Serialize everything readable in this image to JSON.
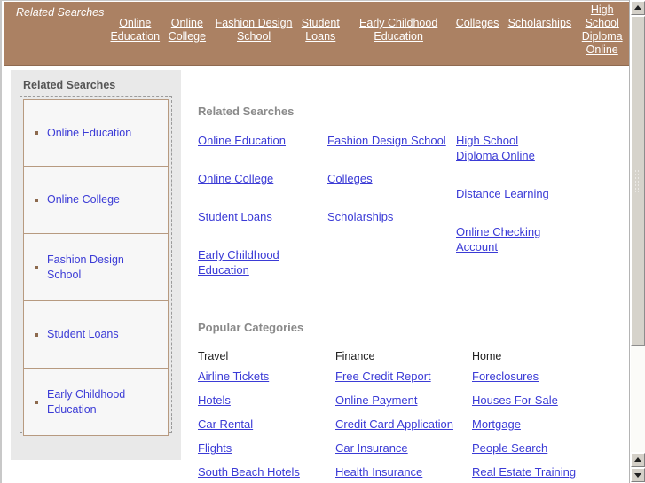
{
  "banner": {
    "title": "Related Searches",
    "links": [
      {
        "label": "Online Education",
        "width": "w-narrow"
      },
      {
        "label": "Online College",
        "width": "w-sm"
      },
      {
        "label": "Fashion Design School",
        "width": "w-med"
      },
      {
        "label": "Student Loans",
        "width": "w-sm"
      },
      {
        "label": "Early Childhood Education",
        "width": "w-wide"
      },
      {
        "label": "Colleges",
        "width": "w-col"
      },
      {
        "label": "Scholarships",
        "width": "w-sch"
      },
      {
        "label": "High School Diploma Online",
        "width": "w-hs"
      }
    ]
  },
  "sidebar": {
    "heading": "Related Searches",
    "items": [
      {
        "label": "Online Education"
      },
      {
        "label": "Online College"
      },
      {
        "label": "Fashion Design School"
      },
      {
        "label": "Student Loans"
      },
      {
        "label": "Early Childhood Education"
      }
    ]
  },
  "main": {
    "related": {
      "heading": "Related Searches",
      "columns": [
        [
          "Online Education",
          "Online College",
          "Student Loans",
          "Early Childhood Education"
        ],
        [
          "Fashion Design School",
          "Colleges",
          "Scholarships"
        ],
        [
          "High School Diploma Online",
          "Distance Learning",
          "Online Checking Account"
        ]
      ]
    },
    "popular": {
      "heading": "Popular Categories",
      "categories": [
        {
          "title": "Travel",
          "links": [
            "Airline Tickets",
            "Hotels",
            "Car Rental",
            "Flights",
            "South Beach Hotels"
          ]
        },
        {
          "title": "Finance",
          "links": [
            "Free Credit Report",
            "Online Payment",
            "Credit Card Application",
            "Car Insurance",
            "Health Insurance"
          ]
        },
        {
          "title": "Home",
          "links": [
            "Foreclosures",
            "Houses For Sale",
            "Mortgage",
            "People Search",
            "Real Estate Training"
          ]
        }
      ]
    }
  },
  "scrollbar": {
    "up_arrow": "scroll-up-arrow",
    "down_arrow": "scroll-down-arrow"
  },
  "colors": {
    "banner_bg": "#ab8163",
    "link": "#3b3bd6",
    "heading": "#8a8a8a",
    "sidebar_bg": "#e9e9e9",
    "item_border": "#b79a80",
    "bullet": "#8d6a4e"
  }
}
